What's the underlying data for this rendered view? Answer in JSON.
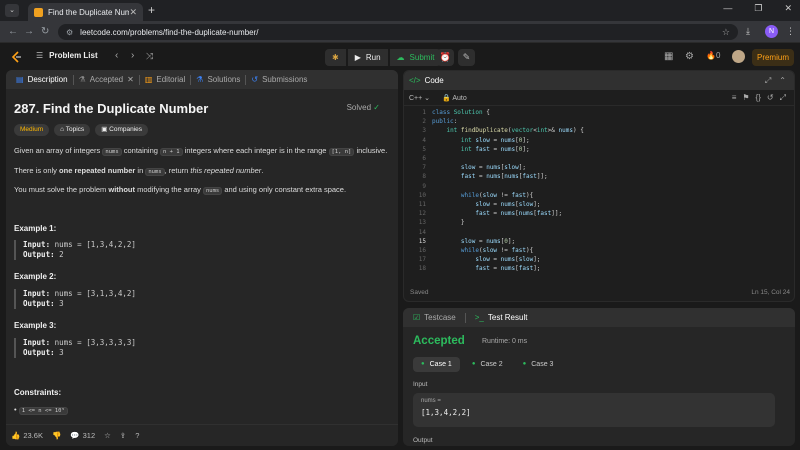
{
  "browser": {
    "tab_title": "Find the Duplicate Number - Le",
    "url": "leetcode.com/problems/find-the-duplicate-number/",
    "profile_initial": "N"
  },
  "nav": {
    "problem_list": "Problem List",
    "run": "Run",
    "submit": "Submit",
    "streak": "0",
    "premium": "Premium"
  },
  "left": {
    "tabs": [
      "Description",
      "Accepted",
      "Editorial",
      "Solutions",
      "Submissions"
    ],
    "title": "287. Find the Duplicate Number",
    "status": "Solved",
    "tags": [
      "Medium",
      "Topics",
      "Companies"
    ],
    "desc": {
      "p1a": "Given an array of integers ",
      "p1code1": "nums",
      "p1b": " containing ",
      "p1code2": "n + 1",
      "p1c": " integers where each integer is in the range ",
      "p1code3": "[1, n]",
      "p1d": " inclusive.",
      "p2a": "There is only ",
      "p2b": "one repeated number",
      "p2c": " in ",
      "p2code": "nums",
      "p2d": ", return ",
      "p2e": "this repeated number",
      "p2f": ".",
      "p3a": "You must solve the problem ",
      "p3b": "without",
      "p3c": " modifying the array ",
      "p3code": "nums",
      "p3d": " and using only constant extra space."
    },
    "examples": [
      {
        "title": "Example 1:",
        "input": "nums = [1,3,4,2,2]",
        "output": "2"
      },
      {
        "title": "Example 2:",
        "input": "nums = [3,1,3,4,2]",
        "output": "3"
      },
      {
        "title": "Example 3:",
        "input": "nums = [3,3,3,3,3]",
        "output": "3"
      }
    ],
    "input_label": "Input:",
    "output_label": "Output:",
    "constraints_title": "Constraints:",
    "constraint1": "1 <= n <= 10⁵",
    "likes": "23.6K",
    "comments": "312"
  },
  "code": {
    "title": "Code",
    "language": "C++",
    "mode": "Auto",
    "saved": "Saved",
    "cursor": "Ln 15, Col 24",
    "current_line": 15,
    "lines": [
      "class Solution {",
      "public:",
      "    int findDuplicate(vector<int>& nums) {",
      "        int slow = nums[0];",
      "        int fast = nums[0];",
      "",
      "        slow = nums[slow];",
      "        fast = nums[nums[fast]];",
      "",
      "        while(slow != fast){",
      "            slow = nums[slow];",
      "            fast = nums[nums[fast]];",
      "        }",
      "",
      "        slow = nums[0];",
      "        while(slow != fast){",
      "            slow = nums[slow];",
      "            fast = nums[fast];"
    ]
  },
  "test": {
    "tabs": [
      "Testcase",
      "Test Result"
    ],
    "verdict": "Accepted",
    "runtime": "Runtime: 0 ms",
    "cases": [
      "Case 1",
      "Case 2",
      "Case 3"
    ],
    "input_label": "Input",
    "var_name": "nums =",
    "var_value": "[1,3,4,2,2]",
    "output_label": "Output"
  },
  "colors": {
    "accent_green": "#2cbb5d",
    "accent_orange": "#ffa116",
    "medium": "#ffb800"
  }
}
